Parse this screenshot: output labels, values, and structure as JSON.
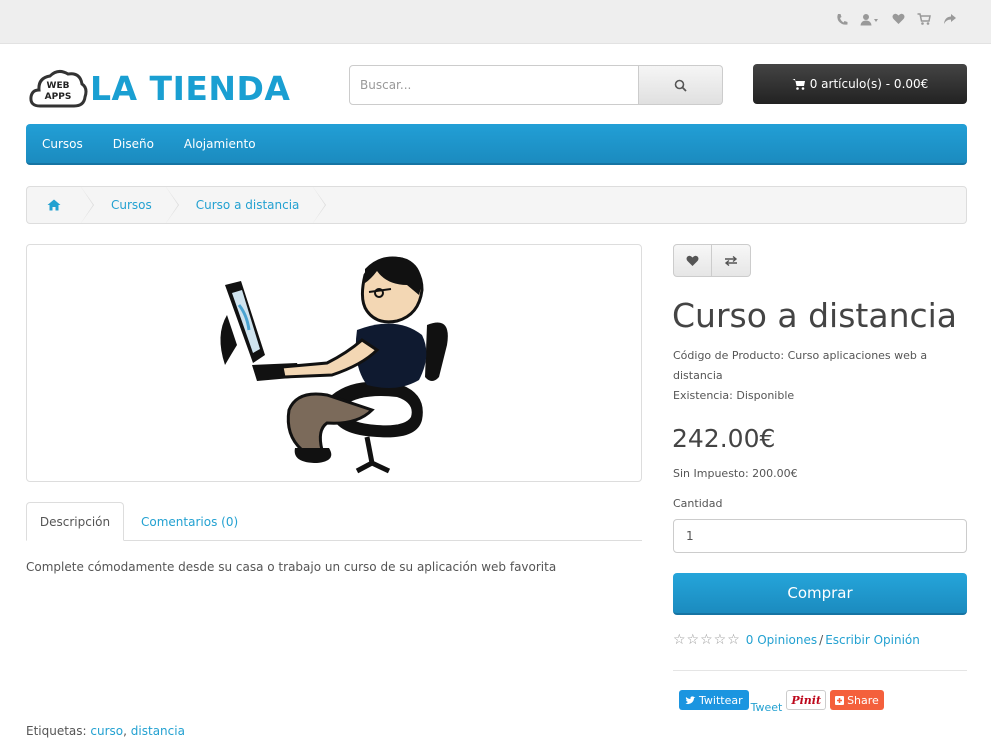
{
  "topbar": {
    "icons": [
      "phone-icon",
      "user-icon",
      "heart-icon",
      "cart-icon",
      "share-icon"
    ]
  },
  "header": {
    "logo_badge": "WEB APPS",
    "brand": "LA TIENDA",
    "search_placeholder": "Buscar...",
    "cart_label": "0 artículo(s) - 0.00€"
  },
  "menu": {
    "items": [
      "Cursos",
      "Diseño",
      "Alojamiento"
    ]
  },
  "breadcrumb": {
    "items": [
      "Cursos",
      "Curso a distancia"
    ]
  },
  "tabs": {
    "description": "Descripción",
    "comments": "Comentarios (0)"
  },
  "description": "Complete cómodamente desde su casa o trabajo un curso de su aplicación web favorita",
  "tags": {
    "label": "Etiquetas:",
    "items": [
      "curso",
      "distancia"
    ]
  },
  "product": {
    "title": "Curso a distancia",
    "code_line": "Código de Producto: Curso aplicaciones web a distancia",
    "stock_line": "Existencia: Disponible",
    "price": "242.00€",
    "tax_line": "Sin Impuesto: 200.00€",
    "qty_label": "Cantidad",
    "qty_value": "1",
    "buy_label": "Comprar",
    "reviews_label": "0 Opiniones",
    "review_sep": "/",
    "write_review_label": "Escribir Opinión",
    "rating": 0,
    "rating_max": 5
  },
  "share": {
    "twitter": "Twittear",
    "tweet": "Tweet",
    "pinit": "Pinit",
    "share": "Share"
  },
  "colors": {
    "accent": "#1b8bbf",
    "brand": "#1a9fd2",
    "cart_bg": "#2b2b2b"
  }
}
